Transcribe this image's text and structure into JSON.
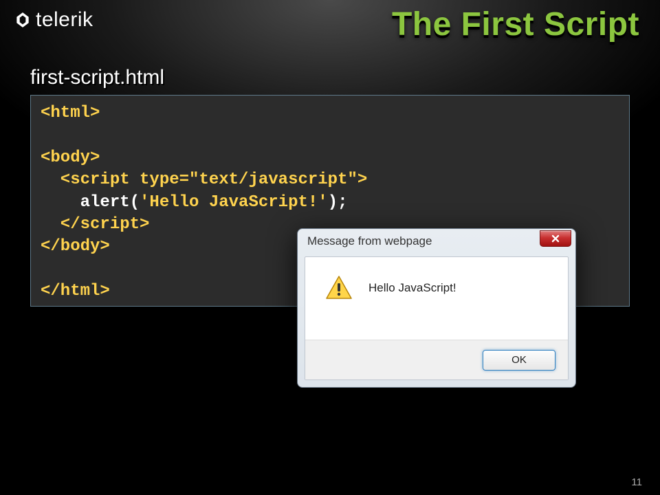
{
  "logo": {
    "text": "telerik"
  },
  "slide": {
    "title": "The First Script",
    "filename": "first-script.html",
    "pageNumber": "11"
  },
  "code": {
    "l1": "<html>",
    "l2": "",
    "l3": "<body>",
    "l4a": "  <script type=",
    "l4b": "\"text/javascript\"",
    "l4c": ">",
    "l5a": "    alert(",
    "l5b": "'Hello JavaScript!'",
    "l5c": ");",
    "l6": "  </script>",
    "l7": "</body>",
    "l8": "",
    "l9": "</html>"
  },
  "dialog": {
    "title": "Message from webpage",
    "message": "Hello JavaScript!",
    "okLabel": "OK"
  }
}
